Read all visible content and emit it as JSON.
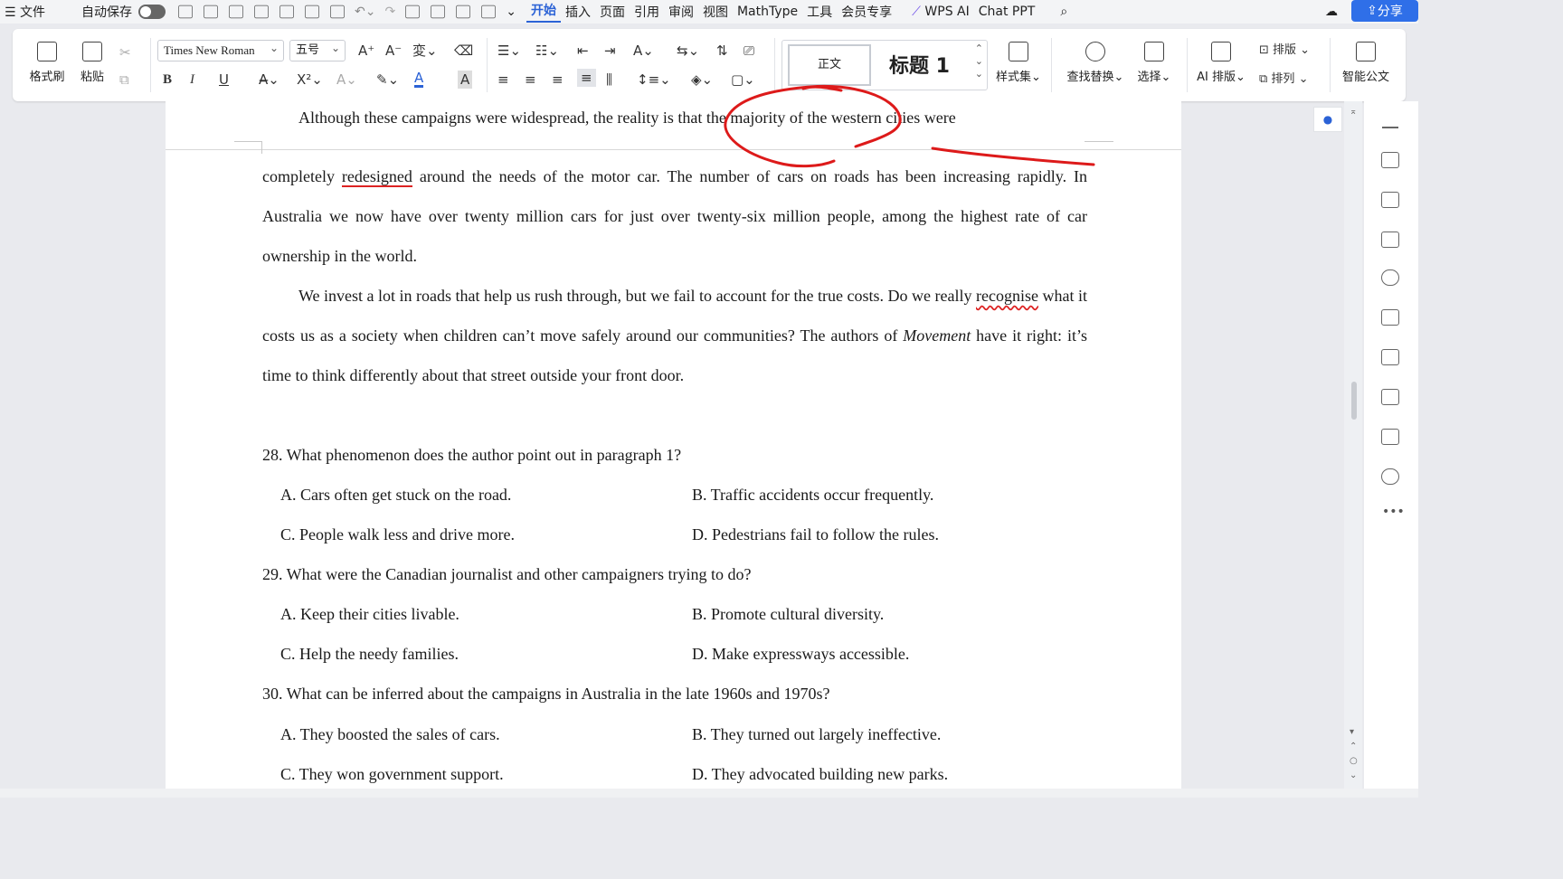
{
  "menubar": {
    "menu_label": "文件",
    "autosave_label": "自动保存",
    "tabs": [
      "开始",
      "插入",
      "页面",
      "引用",
      "审阅",
      "视图",
      "MathType",
      "工具",
      "会员专享",
      "WPS AI",
      "Chat PPT"
    ],
    "active_tab": "开始",
    "share_label": "分享"
  },
  "ribbon": {
    "format_painter": "格式刷",
    "paste": "粘贴",
    "font_name": "Times New Roman",
    "font_size": "五号",
    "style_normal": "正文",
    "style_heading": "标题 1",
    "style_set": "样式集",
    "find_replace": "查找替换",
    "select": "选择",
    "ai_layout": "AI 排版",
    "layout": "排版",
    "arrange": "排列",
    "smart_doc": "智能公文",
    "bold": "B",
    "italic": "I",
    "underline": "U"
  },
  "document": {
    "p1_line1": "Although these campaigns were widespread, the reality is that the majority of the western cities were",
    "p1_rest_pre": "completely ",
    "p1_redesigned": "redesigned",
    "p1_rest_post": " around the needs of the motor car. The number of cars on roads has been increasing rapidly. In Australia we now have over twenty million cars for just over twenty-six million people, among the highest rate of car ownership in the world.",
    "p2_a": "We invest a lot in roads that help us rush through, but we fail to account for the true costs. Do we really ",
    "p2_recognise": "recognise",
    "p2_b": " what it costs us as a society when children can’t move safely around our communities? The authors of ",
    "p2_movement": "Movement",
    "p2_c": " have it right: it’s time to think differently about that street outside your front door.",
    "questions": [
      {
        "stem": "28. What phenomenon does the author point out in paragraph 1?",
        "A": "A. Cars often get stuck on the road.",
        "B": "B. Traffic accidents occur frequently.",
        "C": "C. People walk less and drive more.",
        "D": "D. Pedestrians fail to follow the rules."
      },
      {
        "stem": "29. What were the Canadian journalist and other campaigners trying to do?",
        "A": "A. Keep their cities livable.",
        "B": "B. Promote cultural diversity.",
        "C": "C. Help the needy families.",
        "D": "D. Make expressways accessible."
      },
      {
        "stem": "30. What can be inferred about the campaigns in Australia in the late 1960s and 1970s?",
        "A": "A. They boosted the sales of cars.",
        "B": "B. They turned out largely ineffective.",
        "C": "C. They won government support.",
        "D": "D. They advocated building new parks."
      }
    ]
  },
  "colors": {
    "accent": "#2b62d6",
    "ink": "#dd1a1a"
  }
}
